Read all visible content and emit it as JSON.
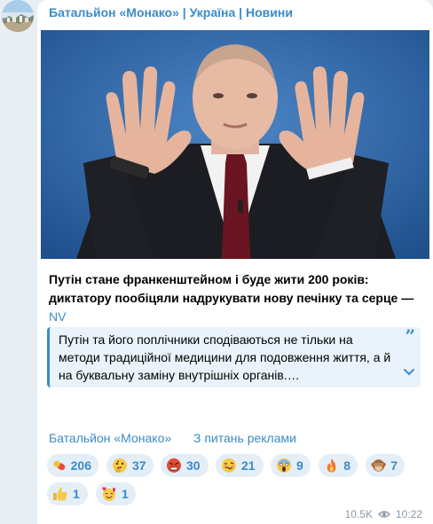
{
  "channel": {
    "name": "Батальйон «Монако» | Україна | Новини"
  },
  "post": {
    "headline": "Путін стане франкенштейном і буде жити 200 років: диктатору пообіцяли надрукувати нову печінку та серце — ",
    "source": "NV",
    "quote": "Путін та його поплічники сподіваються не тільки на методи традиційної медицини для подовження життя, а й на буквальну заміну внутрішніх органів.…",
    "quote_mark": "”",
    "signature": "Батальйон «Монако»",
    "ads_link": "З питань реклами"
  },
  "reactions": [
    {
      "icon": "pill-emoji-icon",
      "count": "206"
    },
    {
      "icon": "thinking-face-emoji-icon",
      "count": "37"
    },
    {
      "icon": "angry-face-emoji-icon",
      "count": "30"
    },
    {
      "icon": "woozy-face-emoji-icon",
      "count": "21"
    },
    {
      "icon": "screaming-face-emoji-icon",
      "count": "9"
    },
    {
      "icon": "fire-emoji-icon",
      "count": "8"
    },
    {
      "icon": "see-no-evil-monkey-emoji-icon",
      "count": "7"
    },
    {
      "icon": "thumbs-up-emoji-icon",
      "count": "1"
    },
    {
      "icon": "smiling-face-with-hearts-emoji-icon",
      "count": "1"
    }
  ],
  "meta": {
    "views": "10.5K",
    "time": "10:22"
  },
  "colors": {
    "link": "#3a8bc8",
    "quote_bg": "#eaf3fb",
    "chip_bg": "#e4eef7",
    "page_bg": "#e9eef2"
  }
}
